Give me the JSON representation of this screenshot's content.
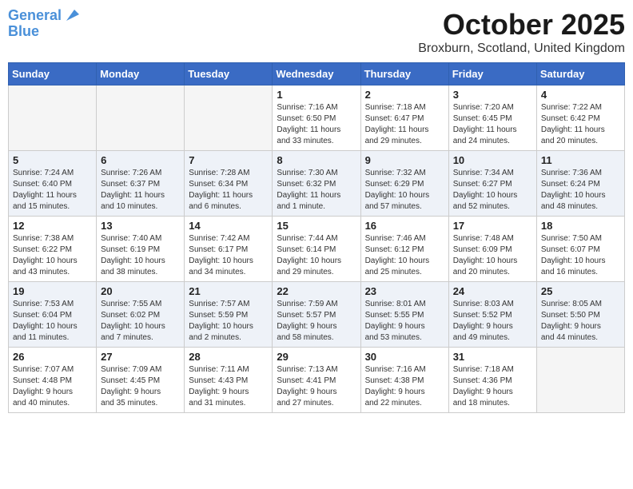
{
  "header": {
    "logo_line1": "General",
    "logo_line2": "Blue",
    "month": "October 2025",
    "location": "Broxburn, Scotland, United Kingdom"
  },
  "days_of_week": [
    "Sunday",
    "Monday",
    "Tuesday",
    "Wednesday",
    "Thursday",
    "Friday",
    "Saturday"
  ],
  "weeks": [
    [
      {
        "day": "",
        "info": ""
      },
      {
        "day": "",
        "info": ""
      },
      {
        "day": "",
        "info": ""
      },
      {
        "day": "1",
        "info": "Sunrise: 7:16 AM\nSunset: 6:50 PM\nDaylight: 11 hours\nand 33 minutes."
      },
      {
        "day": "2",
        "info": "Sunrise: 7:18 AM\nSunset: 6:47 PM\nDaylight: 11 hours\nand 29 minutes."
      },
      {
        "day": "3",
        "info": "Sunrise: 7:20 AM\nSunset: 6:45 PM\nDaylight: 11 hours\nand 24 minutes."
      },
      {
        "day": "4",
        "info": "Sunrise: 7:22 AM\nSunset: 6:42 PM\nDaylight: 11 hours\nand 20 minutes."
      }
    ],
    [
      {
        "day": "5",
        "info": "Sunrise: 7:24 AM\nSunset: 6:40 PM\nDaylight: 11 hours\nand 15 minutes."
      },
      {
        "day": "6",
        "info": "Sunrise: 7:26 AM\nSunset: 6:37 PM\nDaylight: 11 hours\nand 10 minutes."
      },
      {
        "day": "7",
        "info": "Sunrise: 7:28 AM\nSunset: 6:34 PM\nDaylight: 11 hours\nand 6 minutes."
      },
      {
        "day": "8",
        "info": "Sunrise: 7:30 AM\nSunset: 6:32 PM\nDaylight: 11 hours\nand 1 minute."
      },
      {
        "day": "9",
        "info": "Sunrise: 7:32 AM\nSunset: 6:29 PM\nDaylight: 10 hours\nand 57 minutes."
      },
      {
        "day": "10",
        "info": "Sunrise: 7:34 AM\nSunset: 6:27 PM\nDaylight: 10 hours\nand 52 minutes."
      },
      {
        "day": "11",
        "info": "Sunrise: 7:36 AM\nSunset: 6:24 PM\nDaylight: 10 hours\nand 48 minutes."
      }
    ],
    [
      {
        "day": "12",
        "info": "Sunrise: 7:38 AM\nSunset: 6:22 PM\nDaylight: 10 hours\nand 43 minutes."
      },
      {
        "day": "13",
        "info": "Sunrise: 7:40 AM\nSunset: 6:19 PM\nDaylight: 10 hours\nand 38 minutes."
      },
      {
        "day": "14",
        "info": "Sunrise: 7:42 AM\nSunset: 6:17 PM\nDaylight: 10 hours\nand 34 minutes."
      },
      {
        "day": "15",
        "info": "Sunrise: 7:44 AM\nSunset: 6:14 PM\nDaylight: 10 hours\nand 29 minutes."
      },
      {
        "day": "16",
        "info": "Sunrise: 7:46 AM\nSunset: 6:12 PM\nDaylight: 10 hours\nand 25 minutes."
      },
      {
        "day": "17",
        "info": "Sunrise: 7:48 AM\nSunset: 6:09 PM\nDaylight: 10 hours\nand 20 minutes."
      },
      {
        "day": "18",
        "info": "Sunrise: 7:50 AM\nSunset: 6:07 PM\nDaylight: 10 hours\nand 16 minutes."
      }
    ],
    [
      {
        "day": "19",
        "info": "Sunrise: 7:53 AM\nSunset: 6:04 PM\nDaylight: 10 hours\nand 11 minutes."
      },
      {
        "day": "20",
        "info": "Sunrise: 7:55 AM\nSunset: 6:02 PM\nDaylight: 10 hours\nand 7 minutes."
      },
      {
        "day": "21",
        "info": "Sunrise: 7:57 AM\nSunset: 5:59 PM\nDaylight: 10 hours\nand 2 minutes."
      },
      {
        "day": "22",
        "info": "Sunrise: 7:59 AM\nSunset: 5:57 PM\nDaylight: 9 hours\nand 58 minutes."
      },
      {
        "day": "23",
        "info": "Sunrise: 8:01 AM\nSunset: 5:55 PM\nDaylight: 9 hours\nand 53 minutes."
      },
      {
        "day": "24",
        "info": "Sunrise: 8:03 AM\nSunset: 5:52 PM\nDaylight: 9 hours\nand 49 minutes."
      },
      {
        "day": "25",
        "info": "Sunrise: 8:05 AM\nSunset: 5:50 PM\nDaylight: 9 hours\nand 44 minutes."
      }
    ],
    [
      {
        "day": "26",
        "info": "Sunrise: 7:07 AM\nSunset: 4:48 PM\nDaylight: 9 hours\nand 40 minutes."
      },
      {
        "day": "27",
        "info": "Sunrise: 7:09 AM\nSunset: 4:45 PM\nDaylight: 9 hours\nand 35 minutes."
      },
      {
        "day": "28",
        "info": "Sunrise: 7:11 AM\nSunset: 4:43 PM\nDaylight: 9 hours\nand 31 minutes."
      },
      {
        "day": "29",
        "info": "Sunrise: 7:13 AM\nSunset: 4:41 PM\nDaylight: 9 hours\nand 27 minutes."
      },
      {
        "day": "30",
        "info": "Sunrise: 7:16 AM\nSunset: 4:38 PM\nDaylight: 9 hours\nand 22 minutes."
      },
      {
        "day": "31",
        "info": "Sunrise: 7:18 AM\nSunset: 4:36 PM\nDaylight: 9 hours\nand 18 minutes."
      },
      {
        "day": "",
        "info": ""
      }
    ]
  ]
}
